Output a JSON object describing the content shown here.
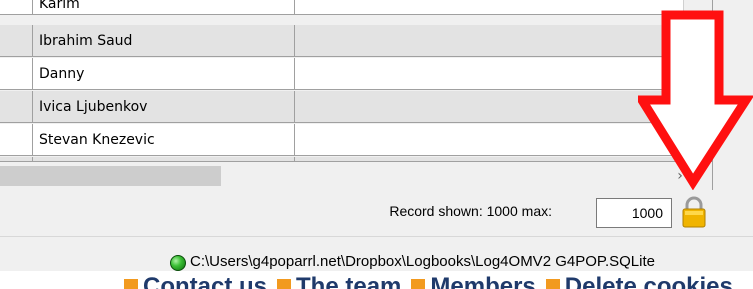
{
  "grid": {
    "rows": [
      {
        "name": "Karim",
        "partial": true
      },
      {
        "name": "Ibrahim Saud"
      },
      {
        "name": "Danny"
      },
      {
        "name": "Ivica Ljubenkov"
      },
      {
        "name": "Stevan Knezevic"
      },
      {
        "name": ""
      }
    ],
    "hscroll_arrow": "›"
  },
  "record": {
    "label": "Record shown:",
    "shown": "1000",
    "max_label": "max:",
    "max_value": "1000"
  },
  "status": {
    "db_path": "C:\\Users\\g4poparrl.net\\Dropbox\\Logbooks\\Log4OMV2 G4POP.SQLite"
  },
  "web_footer": {
    "links": [
      "Contact us",
      "The team",
      "Members",
      "Delete cookies"
    ]
  },
  "colors": {
    "row_shaded": "#e3e3e3",
    "row_white": "#ffffff",
    "grid_line": "#a0a0a0",
    "status_led": "#2eaa2e",
    "annotation_arrow": "#ff1010",
    "lock": "#f0b400",
    "footer_text": "#1f3a6b",
    "footer_bullet": "#f29a1f"
  },
  "icons": [
    "status-led-icon",
    "padlock-icon",
    "chevron-right-icon",
    "down-arrow-annotation"
  ]
}
